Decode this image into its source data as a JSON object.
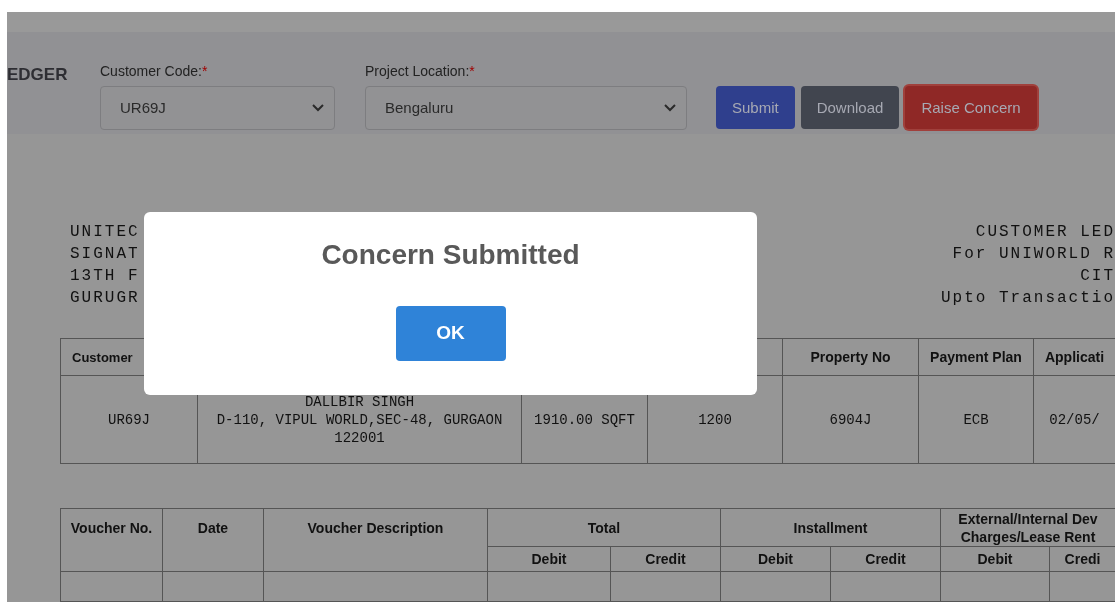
{
  "toolbar": {
    "title": "EDGER",
    "fields": [
      {
        "label": "Customer Code:",
        "required_mark": "*",
        "value": "UR69J"
      },
      {
        "label": "Project Location:",
        "required_mark": "*",
        "value": "Bengaluru"
      }
    ],
    "buttons": [
      {
        "label": "Submit",
        "kind": "primary"
      },
      {
        "label": "Download",
        "kind": "secondary"
      },
      {
        "label": "Raise Concern",
        "kind": "danger"
      }
    ]
  },
  "company_lines": [
    "UNITEC",
    "SIGNAT",
    "13TH F",
    "GURUGR"
  ],
  "report_lines": [
    "CUSTOMER LED",
    "For UNIWORLD R",
    "CIT",
    "Upto Transactio"
  ],
  "customer_table": {
    "columns": [
      "Customer",
      "",
      "",
      "",
      "Property No",
      "Payment Plan",
      "Applicati"
    ],
    "row": [
      [
        "UR69J"
      ],
      [
        "DALLBIR SINGH",
        "D-110, VIPUL WORLD,SEC-48, GURGAON",
        "122001"
      ],
      [
        "1910.00 SQFT"
      ],
      [
        "1200"
      ],
      [
        "6904J"
      ],
      [
        "ECB"
      ],
      [
        "02/05/"
      ]
    ]
  },
  "voucher_table": {
    "columns": [
      "Voucher No.",
      "Date",
      "Voucher Description"
    ],
    "groups": [
      {
        "label": "Total",
        "sub": [
          "Debit",
          "Credit"
        ]
      },
      {
        "label": "Installment",
        "sub": [
          "Debit",
          "Credit"
        ]
      },
      {
        "label": "External/Internal Dev\nCharges/Lease Rent",
        "sub": [
          "Debit",
          "Credi"
        ]
      }
    ]
  },
  "dialog": {
    "title": "Concern Submitted",
    "button": "OK"
  }
}
